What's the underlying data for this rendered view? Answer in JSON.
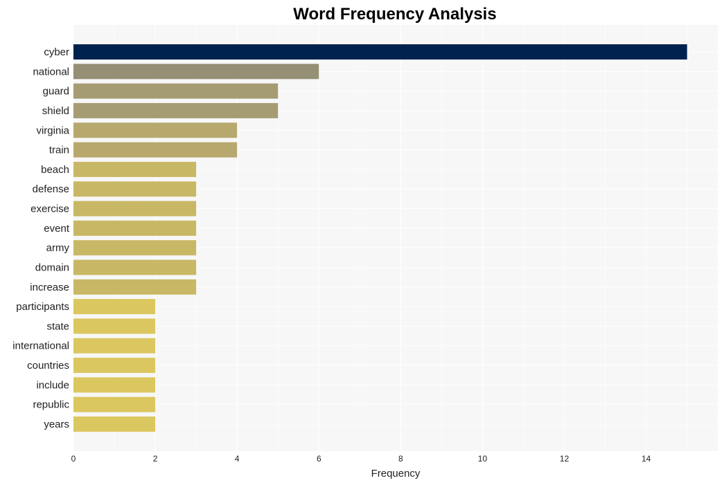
{
  "chart_data": {
    "type": "bar",
    "orientation": "horizontal",
    "title": "Word Frequency Analysis",
    "xlabel": "Frequency",
    "ylabel": "",
    "xlim": [
      0,
      15.75
    ],
    "xticks": [
      0,
      2,
      4,
      6,
      8,
      10,
      12,
      14
    ],
    "grid": true,
    "legend": "none",
    "categories": [
      "cyber",
      "national",
      "guard",
      "shield",
      "virginia",
      "train",
      "beach",
      "defense",
      "exercise",
      "event",
      "army",
      "domain",
      "increase",
      "participants",
      "state",
      "international",
      "countries",
      "include",
      "republic",
      "years"
    ],
    "values": [
      15,
      6,
      5,
      5,
      4,
      4,
      3,
      3,
      3,
      3,
      3,
      3,
      3,
      2,
      2,
      2,
      2,
      2,
      2,
      2
    ],
    "colors": [
      "#00224e",
      "#958f76",
      "#a69c73",
      "#a69c73",
      "#b7a86d",
      "#b7a86d",
      "#c8b866",
      "#c8b866",
      "#c8b866",
      "#c8b866",
      "#c8b866",
      "#c8b866",
      "#c8b866",
      "#dbc75f",
      "#dbc75f",
      "#dbc75f",
      "#dbc75f",
      "#dbc75f",
      "#dbc75f",
      "#dbc75f"
    ]
  },
  "style": {
    "plot_background": "#f7f7f7",
    "grid_color": "#ffffff"
  }
}
